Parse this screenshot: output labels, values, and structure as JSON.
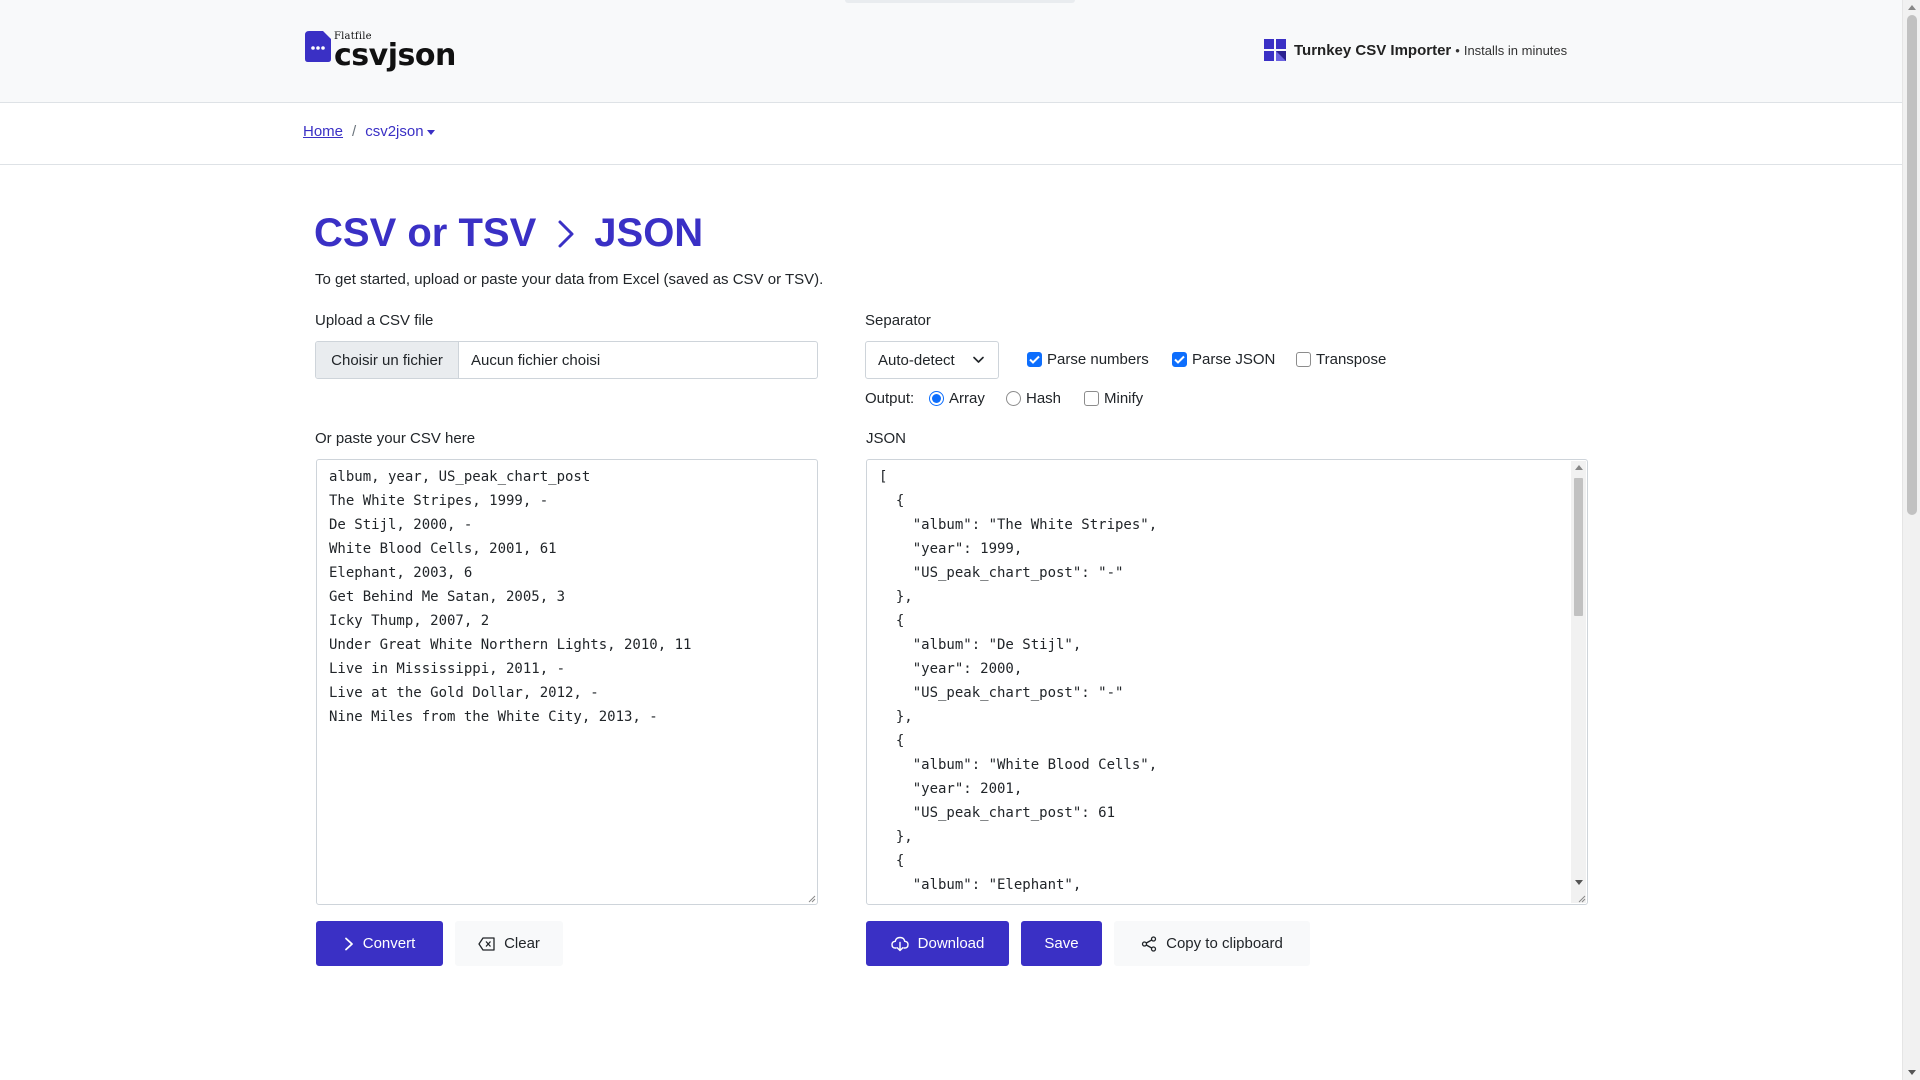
{
  "header": {
    "logo_small": "Flatfile",
    "logo_main": "csvjson",
    "promo_title": "Turnkey CSV Importer",
    "promo_separator": "•",
    "promo_subtitle": "Installs in minutes"
  },
  "breadcrumb": {
    "home": "Home",
    "separator": "/",
    "current": "csv2json"
  },
  "title": {
    "left": "CSV or TSV",
    "right": "JSON"
  },
  "subtitle": "To get started, upload or paste your data from Excel (saved as CSV or TSV).",
  "upload": {
    "label": "Upload a CSV file",
    "button": "Choisir un fichier",
    "status": "Aucun fichier choisi"
  },
  "separator": {
    "label": "Separator",
    "value": "Auto-detect"
  },
  "options": {
    "parse_numbers": {
      "label": "Parse numbers",
      "checked": true
    },
    "parse_json": {
      "label": "Parse JSON",
      "checked": true
    },
    "transpose": {
      "label": "Transpose",
      "checked": false
    }
  },
  "output": {
    "label": "Output:",
    "array": {
      "label": "Array",
      "selected": true
    },
    "hash": {
      "label": "Hash",
      "selected": false
    },
    "minify": {
      "label": "Minify",
      "checked": false
    }
  },
  "csv_input": {
    "label": "Or paste your CSV here",
    "text": "album, year, US_peak_chart_post\nThe White Stripes, 1999, -\nDe Stijl, 2000, -\nWhite Blood Cells, 2001, 61\nElephant, 2003, 6\nGet Behind Me Satan, 2005, 3\nIcky Thump, 2007, 2\nUnder Great White Northern Lights, 2010, 11\nLive in Mississippi, 2011, -\nLive at the Gold Dollar, 2012, -\nNine Miles from the White City, 2013, -"
  },
  "json_output": {
    "label": "JSON",
    "text": "[\n  {\n    \"album\": \"The White Stripes\",\n    \"year\": 1999,\n    \"US_peak_chart_post\": \"-\"\n  },\n  {\n    \"album\": \"De Stijl\",\n    \"year\": 2000,\n    \"US_peak_chart_post\": \"-\"\n  },\n  {\n    \"album\": \"White Blood Cells\",\n    \"year\": 2001,\n    \"US_peak_chart_post\": 61\n  },\n  {\n    \"album\": \"Elephant\","
  },
  "buttons": {
    "convert": "Convert",
    "clear": "Clear",
    "download": "Download",
    "save": "Save",
    "copy": "Copy to clipboard"
  },
  "colors": {
    "brand": "#3a30c5",
    "checkbox": "#0d6efd"
  }
}
